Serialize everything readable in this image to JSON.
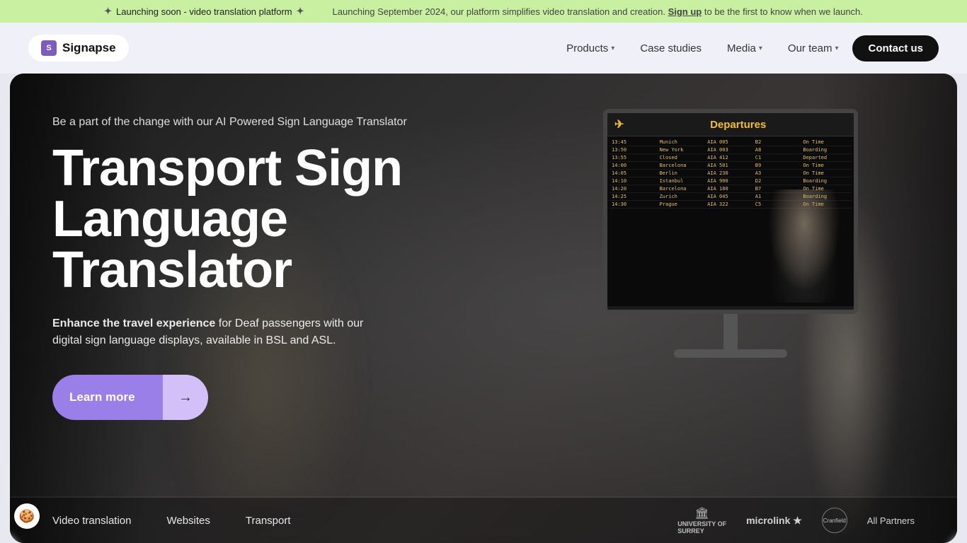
{
  "announcement": {
    "left": "Launching soon - video translation platform",
    "right_prefix": "Launching September 2024, our platform simplifies video translation and creation.",
    "sign_up": "Sign up",
    "right_suffix": "to be the first to know when we launch.",
    "plus_symbol": "+"
  },
  "navbar": {
    "logo_text": "Signapse",
    "nav_items": [
      {
        "label": "Products",
        "has_dropdown": true
      },
      {
        "label": "Case studies",
        "has_dropdown": false
      },
      {
        "label": "Media",
        "has_dropdown": true
      },
      {
        "label": "Our team",
        "has_dropdown": true
      }
    ],
    "contact_label": "Contact us"
  },
  "hero": {
    "subtitle": "Be a part of the change with our AI Powered Sign Language Translator",
    "title_line1": "Transport Sign",
    "title_line2": "Language Translator",
    "description_bold": "Enhance the travel experience",
    "description_rest": " for Deaf passengers with our digital sign language displays, available in BSL and ASL.",
    "cta_label": "Learn more",
    "cta_arrow": "→"
  },
  "departures": {
    "title": "Departures",
    "rows": [
      [
        "13:45",
        "Munich",
        "AIA 005",
        "B2",
        "On Time"
      ],
      [
        "13:50",
        "New York",
        "AIA 003",
        "A8",
        "Boarding"
      ],
      [
        "13:55",
        "Closed",
        "AIA 412",
        "C1",
        "Departed"
      ],
      [
        "14:00",
        "Barcelona",
        "AIA 501",
        "B9",
        "On Time"
      ],
      [
        "14:05",
        "Berlin",
        "AIA 230",
        "A3",
        "On Time"
      ],
      [
        "14:10",
        "Istanbul",
        "AIA 900",
        "D2",
        "Boarding"
      ],
      [
        "14:20",
        "Barcelona",
        "AIA 180",
        "B7",
        "On Time"
      ],
      [
        "14:25",
        "Zurich",
        "AIA 045",
        "A1",
        "Boarding"
      ],
      [
        "14:30",
        "Prague",
        "AIA 322",
        "C5",
        "On Time"
      ]
    ]
  },
  "bottom_nav": [
    {
      "label": "Video translation"
    },
    {
      "label": "Websites"
    },
    {
      "label": "Transport"
    }
  ],
  "partners": {
    "surrey": "University of Surrey",
    "microlink": "microlink",
    "microlink_suffix": "★",
    "cranfield": "Cranfield University",
    "all_partners": "All Partners"
  },
  "cookie": "🍪"
}
